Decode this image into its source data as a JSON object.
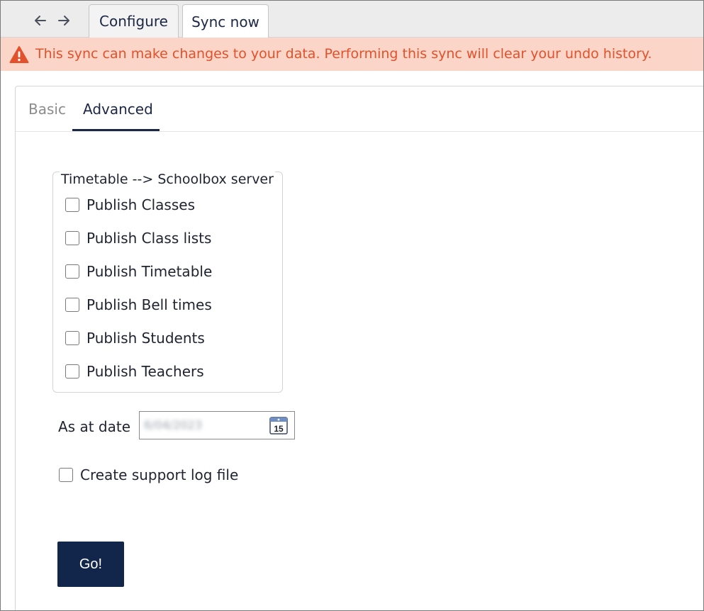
{
  "nav": {
    "back_icon": "arrow-left-icon",
    "forward_icon": "arrow-right-icon"
  },
  "tabs": [
    {
      "label": "Configure",
      "active": false
    },
    {
      "label": "Sync now",
      "active": true
    }
  ],
  "warning": {
    "icon": "warning-triangle-icon",
    "text": "This sync can make changes to your data. Performing this sync will clear your undo history.",
    "color": "#e2512b",
    "background": "#fbd6c8"
  },
  "subtabs": [
    {
      "label": "Basic",
      "active": false
    },
    {
      "label": "Advanced",
      "active": true
    }
  ],
  "group": {
    "legend": "Timetable --> Schoolbox server",
    "options": [
      {
        "label": "Publish Classes",
        "checked": false
      },
      {
        "label": "Publish Class lists",
        "checked": false
      },
      {
        "label": "Publish Timetable",
        "checked": false
      },
      {
        "label": "Publish Bell times",
        "checked": false
      },
      {
        "label": "Publish Students",
        "checked": false
      },
      {
        "label": "Publish Teachers",
        "checked": false
      }
    ]
  },
  "date": {
    "label": "As at date",
    "value": "6/04/2023",
    "calendar_icon": "calendar-icon",
    "calendar_day": "15"
  },
  "support_log": {
    "label": "Create support log file",
    "checked": false
  },
  "go_button": {
    "label": "Go!",
    "color": "#12264b"
  }
}
